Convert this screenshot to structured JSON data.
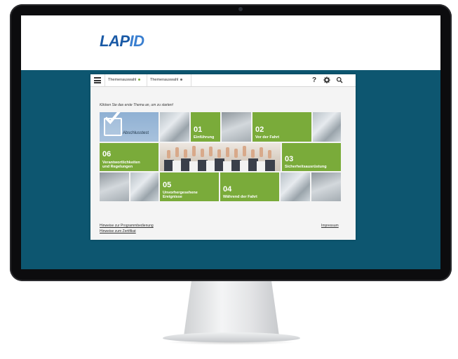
{
  "site": {
    "logo_main": "LAP",
    "logo_accent": "ID"
  },
  "toolbar": {
    "breadcrumbs": [
      {
        "label": "Themenauswahl",
        "dot_color": "#7aab3a"
      },
      {
        "label": "Themenauswahl",
        "dot_color": "#6a6a6a"
      }
    ],
    "help_icon": "?",
    "settings_icon": "gear-icon",
    "search_icon": "search-icon"
  },
  "main": {
    "instruction": "Klicken Sie das erste Thema an, um zu starten!",
    "tiles": [
      {
        "num": "",
        "label": "Abschlusstest"
      },
      {
        "num": "01",
        "label": "Einführung"
      },
      {
        "num": "02",
        "label": "Vor der Fahrt"
      },
      {
        "num": "06",
        "label_line1": "Verantwortlichkeiten",
        "label_line2": "und Regelungen"
      },
      {
        "num": "03",
        "label": "Sicherheitsausrüstung"
      },
      {
        "num": "05",
        "label_line1": "Unvorhergesehene",
        "label_line2": "Ereignisse"
      },
      {
        "num": "04",
        "label": "Während der Fahrt"
      }
    ]
  },
  "footer": {
    "link_program": "Hinweise zur Programmbedienung",
    "link_certificate": "Hinweise zum Zertifikat",
    "link_impressum": "Impressum"
  },
  "colors": {
    "screen_bg": "#0d5670",
    "tile_green": "#7aab3a",
    "logo_blue": "#1a5aa6"
  }
}
